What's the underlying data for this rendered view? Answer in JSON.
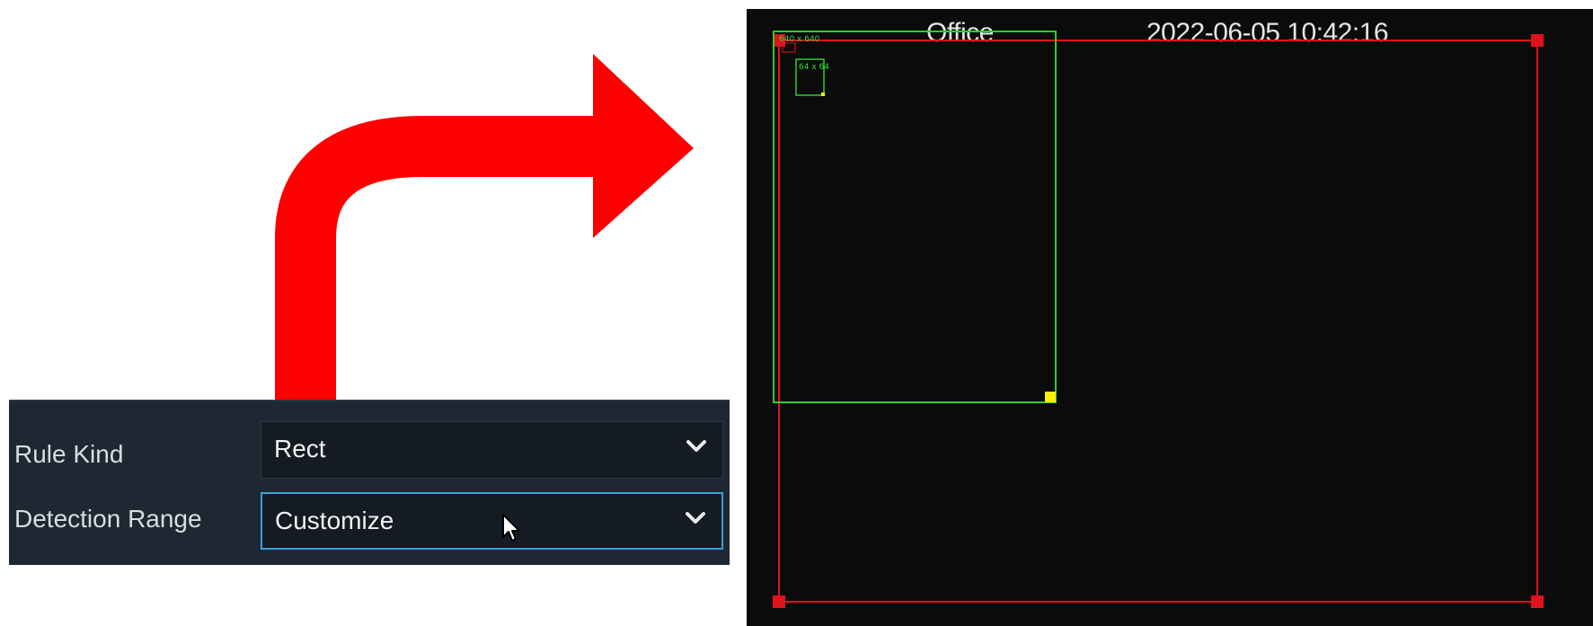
{
  "settings": {
    "rule_kind": {
      "label": "Rule Kind",
      "value": "Rect"
    },
    "detection_range": {
      "label": "Detection Range",
      "value": "Customize"
    }
  },
  "preview": {
    "camera_name": "Office",
    "timestamp": "2022-06-05 10:42:16",
    "max_size_label": "640 x 640",
    "min_size_label": "64 x 64"
  },
  "icons": {
    "arrow": "curved-arrow-icon",
    "dropdown": "chevron-down-icon",
    "cursor": "mouse-pointer-icon"
  },
  "colors": {
    "arrow": "#ff0000",
    "panel_bg": "#1e2833",
    "active_border": "#3aa0d8",
    "detection_area": "#e0121e",
    "target_box": "#2ecc2e",
    "handle_yellow": "#ffee00"
  }
}
